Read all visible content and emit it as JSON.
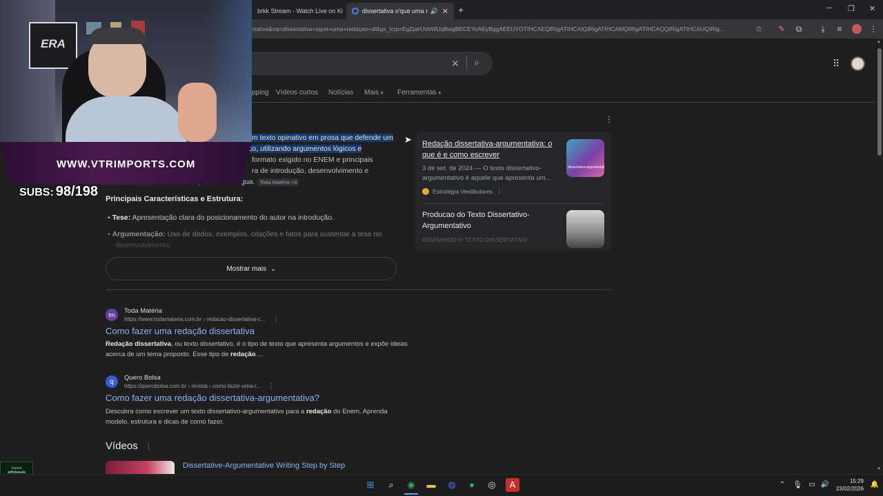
{
  "browser": {
    "tabs": [
      {
        "label": "brkk Stream - Watch Live on Ki"
      },
      {
        "label": "dissertativa o'que uma reda"
      }
    ],
    "url": "rtativa&oq=dissertativa+oque+uma+redaçao+di&gs_lcrp=EgZjaHJvbWUqBwgBECEYoAEyBggAEEUYOTIHCAEQIRigATIHCAIQIRigATIHCAMQIRigATIHCAQQIRigATIHCAUQIRig..."
  },
  "search": {
    "nav": [
      "pping",
      "Vídeos curtos",
      "Notícias",
      "Mais",
      "Ferramentas"
    ]
  },
  "overview": {
    "line1": "m texto opinativo em prosa que defende um",
    "line2": "ponto de vista (tese) sobre um tema específico, utilizando argumentos lógicos e",
    "line3": "formato exigido no ENEM e principais",
    "line4": "ra de introdução, desenvolvimento e",
    "line5": "conclusão, escrita na norma-padrão da língua.",
    "chip": "Toda Matéria +3",
    "section_title": "Principais Características e Estrutura:",
    "bullets": [
      {
        "term": "Tese:",
        "text": " Apresentação clara do posicionamento do autor na introdução."
      },
      {
        "term": "Argumentação:",
        "text": " Uso de dados, exemplos, citações e fatos para sustentar a tese no"
      },
      {
        "term": "",
        "text": "desenvolvimento."
      }
    ],
    "more_label": "Mostrar mais"
  },
  "cards": [
    {
      "title": "Redação dissertativa-argumentativa: o que é e como escrever",
      "snippet": "3 de set. de 2024 — O texto dissertativo-argumentativo é aquele que apresenta um...",
      "source": "Estratégia Vestibulares",
      "thumb_label": "dissertativa-argumentativa"
    },
    {
      "title": "Producao do Texto Dissertativo-Argumentativo",
      "snippet": "REVISANDO O TEXTO DISSERTATIVO-"
    }
  ],
  "results": [
    {
      "site": "Toda Matéria",
      "url": "https://www.todamateria.com.br › redacao-dissertativa-c...",
      "title": "Como fazer uma redação dissertativa",
      "favicon": "tm",
      "snippet_b1": "Redação dissertativa",
      "snippet_t1": ", ou texto dissertativo, é o tipo de texto que apresenta argumentos e expõe ideias acerca de um tema proposto. Esse tipo de ",
      "snippet_b2": "redação",
      "snippet_t2": " ..."
    },
    {
      "site": "Quero Bolsa",
      "url": "https://querobolsa.com.br › revista › como-fazer-uma-r...",
      "title": "Como fazer uma redação dissertativa-argumentativa?",
      "favicon": "q",
      "snippet_t0": "Descubra como escrever um texto dissertativo-argumentativo para a ",
      "snippet_b1": "redação",
      "snippet_t1": " do Enem. Aprenda modelo, estrutura e dicas de como fazer."
    }
  ],
  "videos": {
    "heading": "Vídeos",
    "first_title": "Dissertative-Argumentative Writing Step by Step"
  },
  "overlay": {
    "site": "WWW.VTRIMPORTS.COM",
    "subs_label": "SUBS:",
    "subs_value": "98/198",
    "logo_text": "ERA",
    "badge_line1": "Instant",
    "badge_line2": "withdrawals"
  },
  "taskbar": {
    "time": "15:29",
    "date": "23/02/2026"
  },
  "colors": {
    "link": "#8ab4f8",
    "highlight": "#1a3a6b",
    "accent_purple": "#4a1a4f"
  }
}
